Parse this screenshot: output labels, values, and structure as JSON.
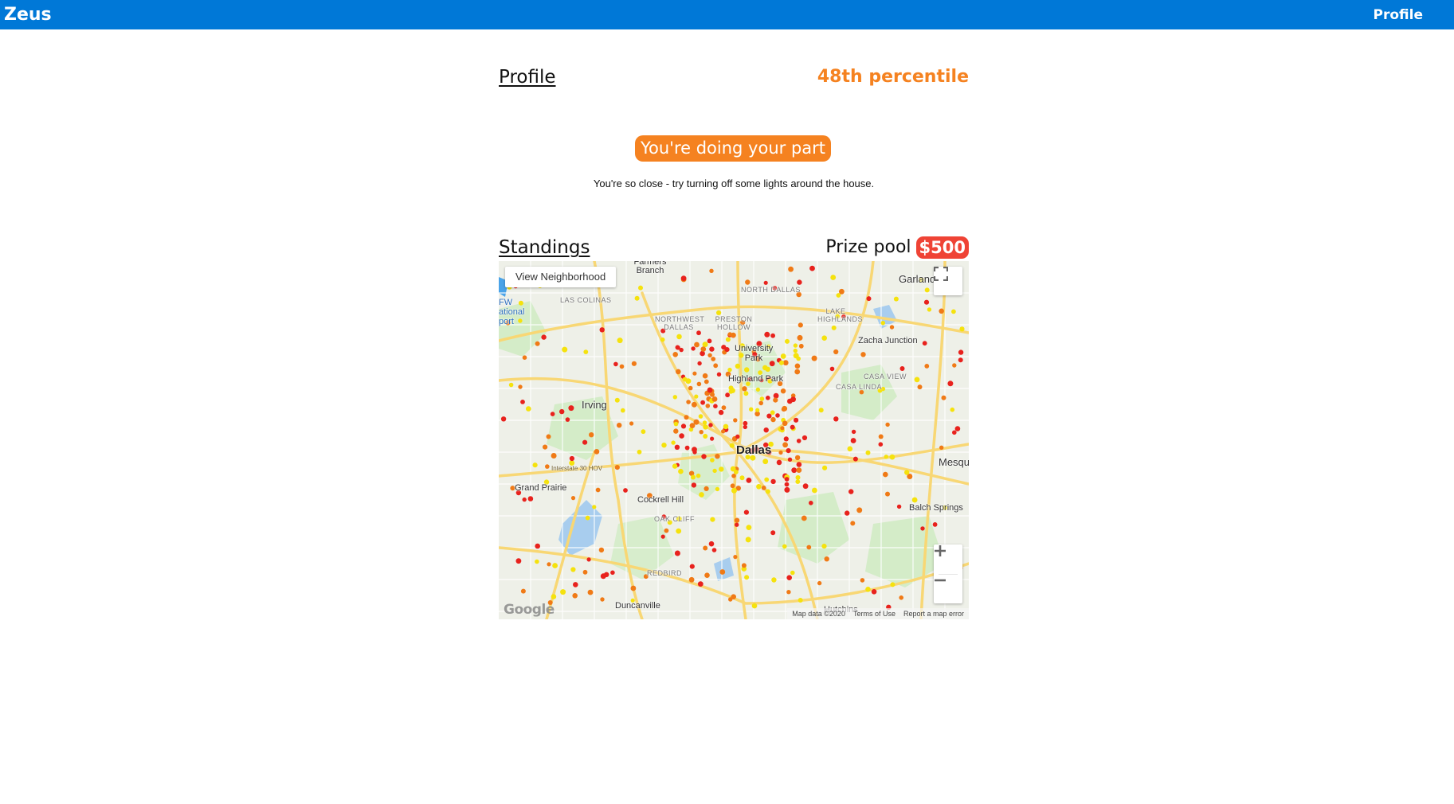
{
  "header": {
    "brand": "Zeus",
    "nav_profile": "Profile"
  },
  "profile": {
    "title": "Profile",
    "percentile": "48th percentile"
  },
  "status": {
    "badge": "You're doing your part",
    "tip": "You're so close - try turning off some lights around the house."
  },
  "standings": {
    "title": "Standings",
    "prize_label": "Prize pool",
    "prize_amount": "$500"
  },
  "map": {
    "view_neighborhood": "View Neighborhood",
    "attribution": {
      "data": "Map data ©2020",
      "terms": "Terms of Use",
      "report": "Report a map error"
    },
    "logo": "Google",
    "places": {
      "dallas": "Dallas",
      "irving": "Irving",
      "grand_prairie": "Grand Prairie",
      "cockrell_hill": "Cockrell Hill",
      "duncanville": "Duncanville",
      "university_park": "University Park",
      "highland_park": "Highland Park",
      "zacha_junction": "Zacha Junction",
      "balch_springs": "Balch Springs",
      "garland": "Garland",
      "mesquite": "Mesqu",
      "farmers_branch": "Farmers Branch",
      "las_colinas": "LAS COLINAS",
      "northwest_dallas": "NORTHWEST DALLAS",
      "preston_hollow": "PRESTON HOLLOW",
      "north_dallas": "NORTH DALLAS",
      "lake_highlands": "LAKE HIGHLANDS",
      "casa_view": "CASA VIEW",
      "casa_linda": "CASA LINDA",
      "oak_cliff": "OAK CLIFF",
      "redbird": "REDBIRD",
      "hutchins": "Hutchins",
      "dfw_airport": "FW ational port",
      "interstate_hov": "Interstate 30 HOV"
    }
  },
  "colors": {
    "topbar": "#0078d7",
    "accent_orange": "#f58220",
    "prize_red": "#ef4335",
    "heat_red": "#e8221d",
    "heat_orange": "#f07a16",
    "heat_yellow": "#f5e20d"
  },
  "icons": {
    "fullscreen": "fullscreen-icon",
    "zoom_in": "plus-icon",
    "zoom_out": "minus-icon"
  }
}
